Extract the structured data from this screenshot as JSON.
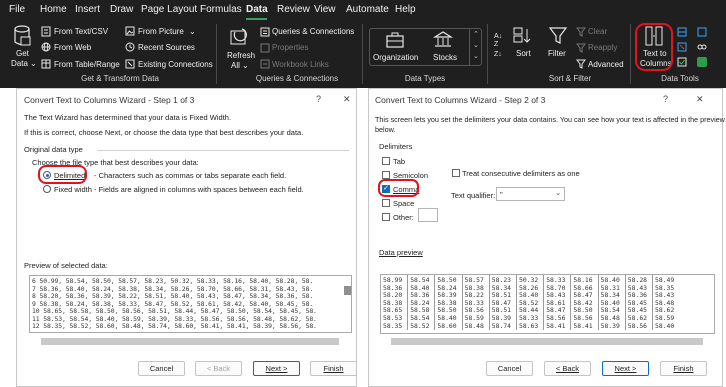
{
  "menubar": {
    "items": [
      "File",
      "Home",
      "Insert",
      "Draw",
      "Page Layout",
      "Formulas",
      "Data",
      "Review",
      "View",
      "Automate",
      "Help"
    ],
    "active": "Data"
  },
  "ribbon": {
    "get_transform": {
      "get_data": "Get",
      "get_data2": "Data",
      "from_text_csv": "From Text/CSV",
      "from_web": "From Web",
      "from_table_range": "From Table/Range",
      "from_picture": "From Picture",
      "recent_sources": "Recent Sources",
      "existing_connections": "Existing Connections",
      "label": "Get & Transform Data"
    },
    "queries": {
      "refresh": "Refresh",
      "refresh_all": "All",
      "queries_connections": "Queries & Connections",
      "properties": "Properties",
      "workbook_links": "Workbook Links",
      "label": "Queries & Connections"
    },
    "data_types": {
      "organization": "Organization",
      "stocks": "Stocks",
      "label": "Data Types"
    },
    "sort_filter": {
      "sort": "Sort",
      "filter": "Filter",
      "clear": "Clear",
      "reapply": "Reapply",
      "advanced": "Advanced",
      "label": "Sort & Filter"
    },
    "data_tools": {
      "text_to": "Text to",
      "columns": "Columns",
      "label": "Data Tools"
    }
  },
  "dialog1": {
    "title": "Convert Text to Columns Wizard - Step 1 of 3",
    "help": "?",
    "close": "✕",
    "line1": "The Text Wizard has determined that your data is Fixed Width.",
    "line2": "If this is correct, choose Next, or choose the data type that best describes your data.",
    "group_label": "Original data type",
    "choose_label": "Choose the file type that best describes your data:",
    "delimited_label": "Delimited",
    "delimited_desc": "- Characters such as commas or tabs separate each field.",
    "fixed_label": "Fixed width",
    "fixed_desc": "- Fields are aligned in columns with spaces between each field.",
    "preview_label": "Preview of selected data:",
    "preview_rows": [
      "6 50.99, 58.54, 58.50, 58.57, 58.23, 50.32, 58.33, 58.16, 58.40, 58.28, 58.",
      "7 58.36, 58.40, 58.24, 58.38, 58.34, 58.26, 58.70, 58.66, 58.31, 58.43, 58.",
      "8 58.20, 58.36, 58.39, 58.22, 58.51, 58.40, 58.43, 58.47, 58.34, 58.36, 58.",
      "9 58.38, 58.24, 58.38, 58.33, 58.47, 58.52, 58.61, 58.42, 58.40, 58.45, 58.",
      "10 58.65, 58.58, 58.50, 58.56, 58.51, 58.44, 58.47, 58.50, 58.54, 58.45, 58.",
      "11 58.53, 58.54, 58.40, 58.59, 58.39, 58.33, 58.56, 58.56, 58.48, 58.62, 58.",
      "12 58.35, 58.52, 58.60, 58.48, 58.74, 58.60, 58.41, 58.41, 58.39, 58.56, 58."
    ],
    "cancel": "Cancel",
    "back": "< Back",
    "next": "Next >",
    "finish": "Finish"
  },
  "dialog2": {
    "title": "Convert Text to Columns Wizard - Step 2 of 3",
    "help": "?",
    "close": "✕",
    "intro1": "This screen lets you set the delimiters your data contains.  You can see how your text is affected in the preview",
    "intro2": "below.",
    "delimiters_label": "Delimiters",
    "tab": "Tab",
    "semicolon": "Semicolon",
    "comma": "Comma",
    "space": "Space",
    "other": "Other:",
    "treat_consecutive": "Treat consecutive delimiters as one",
    "text_qualifier_label": "Text qualifier:",
    "text_qualifier_value": "\"",
    "data_preview_label": "Data preview",
    "preview_table": [
      [
        "58.99",
        "58.54",
        "58.50",
        "58.57",
        "58.23",
        "50.32",
        "58.33",
        "58.16",
        "58.40",
        "58.28",
        "58.49"
      ],
      [
        "58.36",
        "58.40",
        "58.24",
        "58.38",
        "58.34",
        "58.26",
        "58.70",
        "58.66",
        "58.31",
        "58.43",
        "58.35"
      ],
      [
        "58.20",
        "58.36",
        "58.39",
        "58.22",
        "58.51",
        "58.40",
        "58.43",
        "58.47",
        "58.34",
        "58.36",
        "58.43"
      ],
      [
        "58.38",
        "58.24",
        "58.38",
        "58.33",
        "58.47",
        "58.52",
        "58.61",
        "58.42",
        "58.40",
        "58.45",
        "58.48"
      ],
      [
        "58.65",
        "58.58",
        "58.50",
        "58.56",
        "58.51",
        "58.44",
        "58.47",
        "58.50",
        "58.54",
        "58.45",
        "58.62"
      ],
      [
        "58.53",
        "58.54",
        "58.40",
        "58.59",
        "58.39",
        "58.33",
        "58.56",
        "58.56",
        "58.48",
        "58.62",
        "58.59"
      ],
      [
        "58.35",
        "58.52",
        "58.60",
        "58.48",
        "58.74",
        "58.63",
        "58.41",
        "58.41",
        "58.39",
        "58.56",
        "58.40"
      ]
    ],
    "cancel": "Cancel",
    "back": "< Back",
    "next": "Next >",
    "finish": "Finish"
  },
  "colors": {
    "ribbon_bg": "#1f1f1f",
    "accent_green": "#3a9f5f",
    "highlight_red": "#e0141e",
    "primary_blue": "#0f6cbd"
  }
}
